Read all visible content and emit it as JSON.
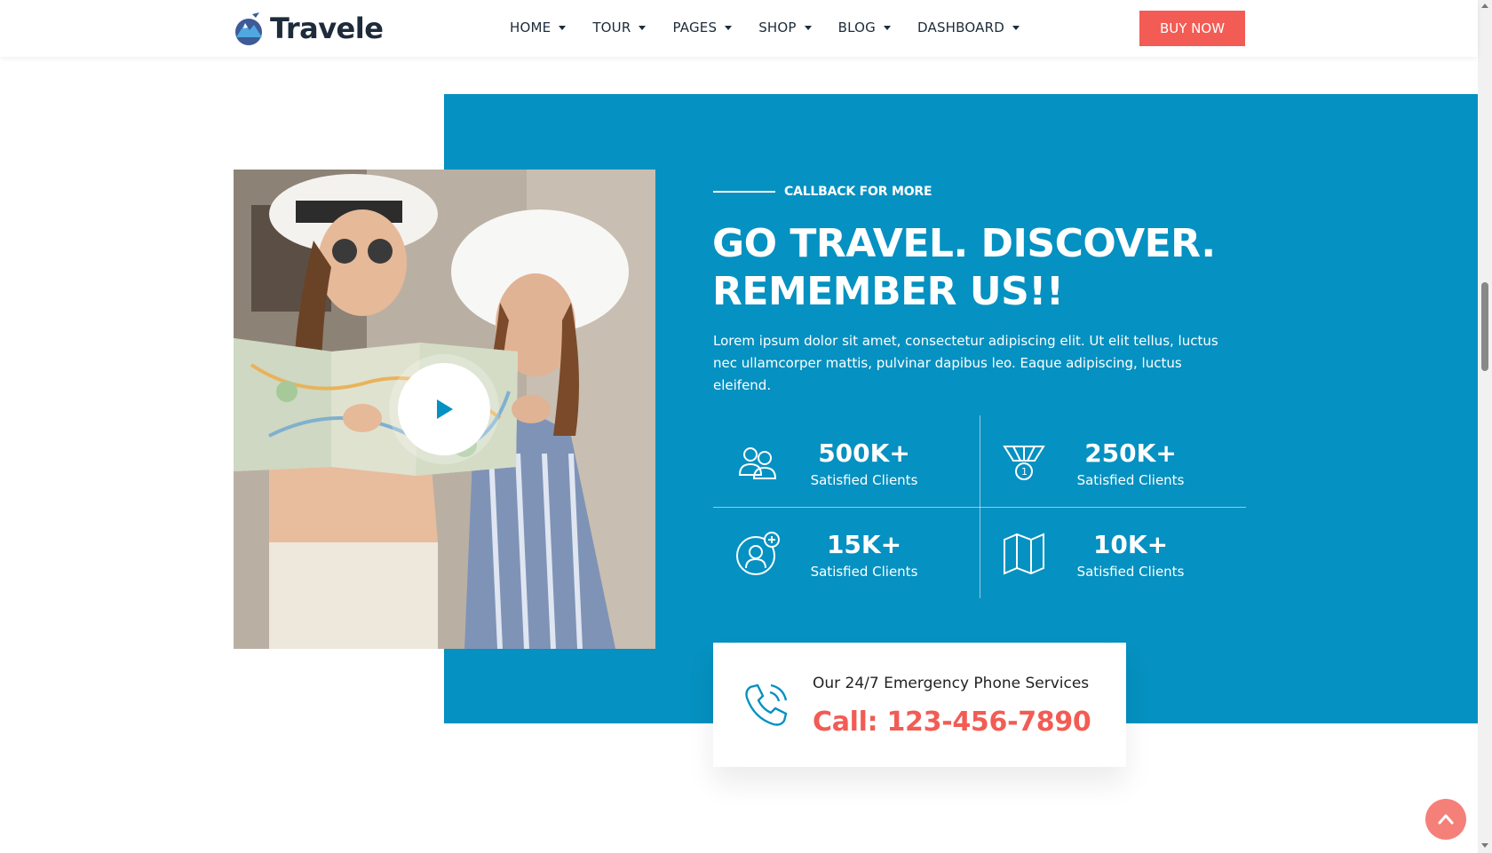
{
  "brand": {
    "name": "Travele"
  },
  "nav": {
    "items": [
      {
        "label": "HOME"
      },
      {
        "label": "TOUR"
      },
      {
        "label": "PAGES"
      },
      {
        "label": "SHOP"
      },
      {
        "label": "BLOG"
      },
      {
        "label": "DASHBOARD"
      }
    ],
    "cta_label": "BUY NOW"
  },
  "hero": {
    "eyebrow": "CALLBACK FOR MORE",
    "headline_line1": "GO TRAVEL. DISCOVER.",
    "headline_line2": "REMEMBER US!!",
    "description": "Lorem ipsum dolor sit amet, consectetur adipiscing elit. Ut elit tellus, luctus nec ullamcorper mattis, pulvinar dapibus leo. Eaque adipiscing, luctus eleifend."
  },
  "stats": [
    {
      "value": "500K+",
      "label": "Satisfied Clients",
      "icon": "users-icon"
    },
    {
      "value": "250K+",
      "label": "Satisfied Clients",
      "icon": "medal-icon"
    },
    {
      "value": "15K+",
      "label": "Satisfied Clients",
      "icon": "user-plus-icon"
    },
    {
      "value": "10K+",
      "label": "Satisfied Clients",
      "icon": "map-icon"
    }
  ],
  "call": {
    "title": "Our 24/7 Emergency Phone Services",
    "number": "Call: 123-456-7890"
  },
  "colors": {
    "primary_blue": "#0591c1",
    "accent_coral": "#f25c54",
    "dark_text": "#1d2b3a"
  }
}
